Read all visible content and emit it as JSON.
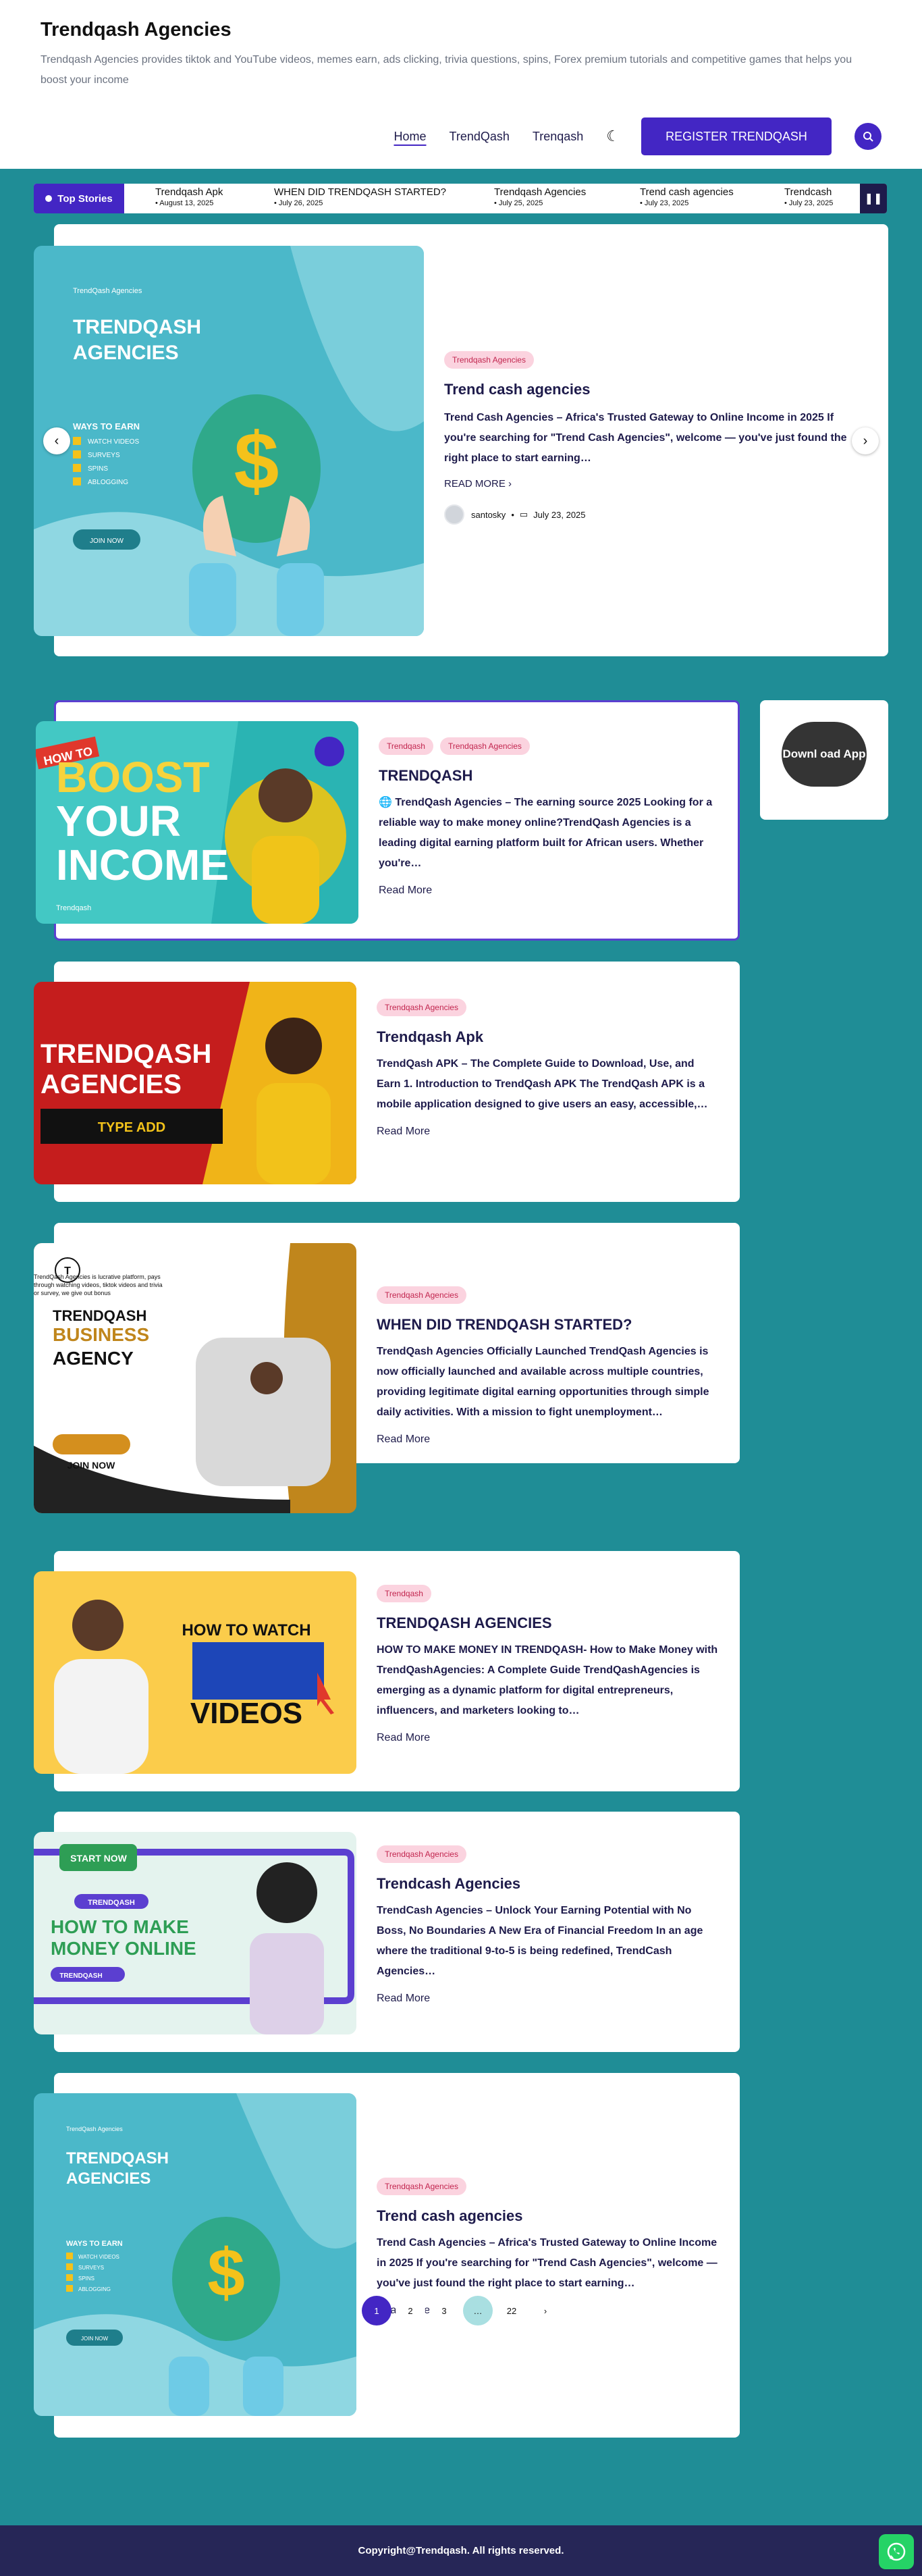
{
  "site": {
    "title": "Trendqash Agencies",
    "tagline": "Trendqash Agencies provides tiktok and YouTube videos, memes earn, ads clicking, trivia questions, spins, Forex premium tutorials and competitive games that helps you boost your income"
  },
  "nav": {
    "items": [
      {
        "label": "Home",
        "active": true
      },
      {
        "label": "TrendQash",
        "active": false
      },
      {
        "label": "Trenqash",
        "active": false
      }
    ],
    "register_label": "REGISTER TRENDQASH"
  },
  "ticker": {
    "label": "Top Stories",
    "items": [
      {
        "title": "Trendqash Apk",
        "date": "• August 13, 2025"
      },
      {
        "title": "WHEN DID TRENDQASH STARTED?",
        "date": "• July 26, 2025"
      },
      {
        "title": "Trendqash Agencies",
        "date": "• July 25, 2025"
      },
      {
        "title": "Trend cash agencies",
        "date": "• July 23, 2025"
      },
      {
        "title": "Trendcash",
        "date": "• July 23, 2025"
      }
    ]
  },
  "hero": {
    "badge": "Trendqash Agencies",
    "title": "Trend cash agencies",
    "excerpt": "Trend Cash Agencies – Africa's Trusted Gateway to Online Income in 2025 If you're searching for \"Trend Cash Agencies\", welcome — you've just found the right place to start earning…",
    "read_more": "READ MORE",
    "author": "santosky",
    "date": "July 23, 2025",
    "image": {
      "brand": "TrendQash Agencies",
      "heading1": "TRENDQASH",
      "heading2": "AGENCIES",
      "ways": "WAYS TO EARN",
      "list": [
        "WATCH VIDEOS",
        "SURVEYS",
        "SPINS",
        "ABLOGGING"
      ],
      "cta": "JOIN NOW"
    }
  },
  "posts": [
    {
      "tags": [
        "Trendqash",
        "Trendqash Agencies"
      ],
      "title": "TRENDQASH",
      "excerpt": "🌐 TrendQash Agencies – The earning source 2025 Looking for a reliable way to make money online?TrendQash Agencies is a leading digital earning platform built for African users. Whether you're…",
      "read_more": "Read More",
      "image": {
        "howto": "HOW TO",
        "l1": "BOOST",
        "l2": "YOUR",
        "l3": "INCOME",
        "brand": "Trendqash"
      }
    },
    {
      "tags": [
        "Trendqash Agencies"
      ],
      "title": "Trendqash Apk",
      "excerpt": "TrendQash APK – The Complete Guide to Download, Use, and Earn 1. Introduction to TrendQash APK The TrendQash APK is a mobile application designed to give users an easy, accessible,…",
      "read_more": "Read More",
      "image": {
        "l1": "TRENDQASH",
        "l2": "AGENCIES",
        "bar": "TYPE ADD"
      }
    },
    {
      "tags": [
        "Trendqash Agencies"
      ],
      "title": "WHEN DID TRENDQASH STARTED?",
      "excerpt": "TrendQash Agencies Officially Launched TrendQash Agencies is now officially launched and available across multiple countries, providing legitimate digital earning opportunities through simple daily activities. With a mission to fight unemployment…",
      "read_more": "Read More",
      "image": {
        "l1": "TRENDQASH",
        "l2": "BUSINESS",
        "l3": "AGENCY",
        "small": "TrendQash Agencies is lucrative platform, pays through watching videos, tiktok videos and trivia or survey, we give out bonus",
        "cta": "JOIN NOW",
        "logo": "T"
      }
    },
    {
      "tags": [
        "Trendqash"
      ],
      "title": "TRENDQASH AGENCIES",
      "excerpt": "HOW TO MAKE MONEY IN TRENDQASH- How to Make Money with TrendQashAgencies: A Complete Guide TrendQashAgencies is emerging as a dynamic platform for digital entrepreneurs, influencers, and marketers looking to…",
      "read_more": "Read More",
      "image": {
        "l1": "HOW TO WATCH",
        "l2": "VIDEOS"
      }
    },
    {
      "tags": [
        "Trendqash Agencies"
      ],
      "title": "Trendcash Agencies",
      "excerpt": "TrendCash Agencies – Unlock Your Earning Potential with No Boss, No Boundaries A New Era of Financial Freedom In an age where the traditional 9-to-5 is being redefined, TrendCash Agencies…",
      "read_more": "Read More",
      "image": {
        "start": "START NOW",
        "tag": "TRENDQASH",
        "l1": "HOW TO MAKE",
        "l2": "MONEY ONLINE",
        "pill": "TRENDQASH"
      }
    },
    {
      "tags": [
        "Trendqash Agencies"
      ],
      "title": "Trend cash agencies",
      "excerpt": "Trend Cash Agencies – Africa's Trusted Gateway to Online Income in 2025 If you're searching for \"Trend Cash Agencies\", welcome — you've just found the right place to start earning…",
      "read_more": "Read More",
      "image": {
        "brand": "TrendQash Agencies",
        "heading1": "TRENDQASH",
        "heading2": "AGENCIES",
        "ways": "WAYS TO EARN",
        "list": [
          "WATCH VIDEOS",
          "SURVEYS",
          "SPINS",
          "ABLOGGING"
        ],
        "cta": "JOIN NOW"
      }
    }
  ],
  "sidebar": {
    "download_label": "Downl oad App"
  },
  "pagination": [
    "1",
    "2",
    "3",
    "…",
    "22"
  ],
  "footer": {
    "copyright": "Copyright@Trendqash. All rights reserved."
  },
  "colors": {
    "brand": "#4326c4",
    "background": "#1f8d96",
    "footer": "#262657",
    "badge_bg": "#fbd3df",
    "badge_text": "#c2264f"
  }
}
